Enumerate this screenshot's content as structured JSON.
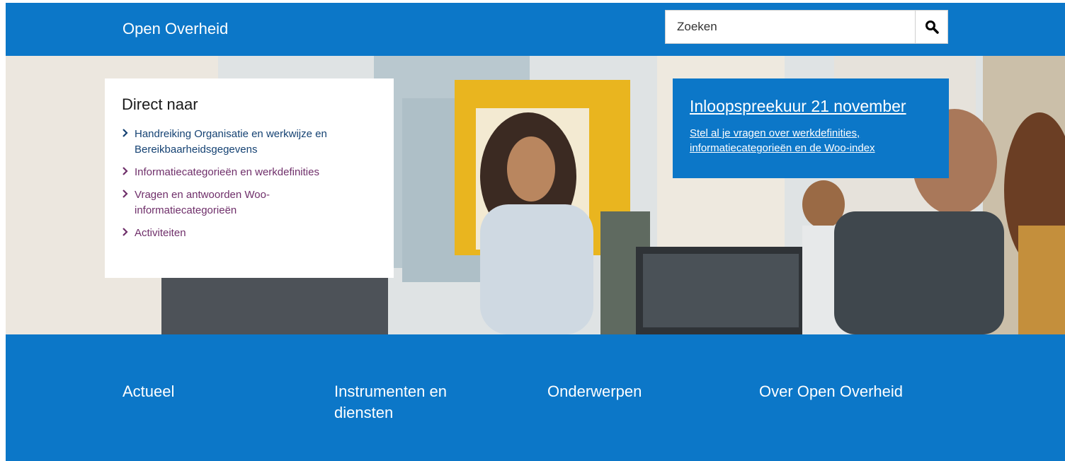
{
  "header": {
    "site_title": "Open Overheid",
    "search": {
      "placeholder": "Zoeken",
      "button_icon": "search-icon"
    }
  },
  "hero": {
    "direct": {
      "title": "Direct naar",
      "items": [
        {
          "label": "Handreiking Organisatie en werkwijze en Bereikbaarheidsgegevens",
          "visited": false
        },
        {
          "label": "Informatiecategorieën en werkdefinities",
          "visited": true
        },
        {
          "label": "Vragen en antwoorden Woo-informatiecategorieën",
          "visited": true
        },
        {
          "label": "Activiteiten",
          "visited": true
        }
      ]
    },
    "promo": {
      "title": "Inloopspreekuur 21 november",
      "text": "Stel al je vragen over werkdefinities, informatiecategorieën en de Woo-index"
    }
  },
  "footer_nav": {
    "items": [
      {
        "label": "Actueel"
      },
      {
        "label": "Instrumenten en diensten"
      },
      {
        "label": "Onderwerpen"
      },
      {
        "label": "Over Open Overheid"
      }
    ]
  },
  "colors": {
    "brand_blue": "#0c77c8",
    "link_blue": "#154273",
    "link_visited": "#6f2f6a",
    "accent_yellow": "#e9b51f"
  }
}
